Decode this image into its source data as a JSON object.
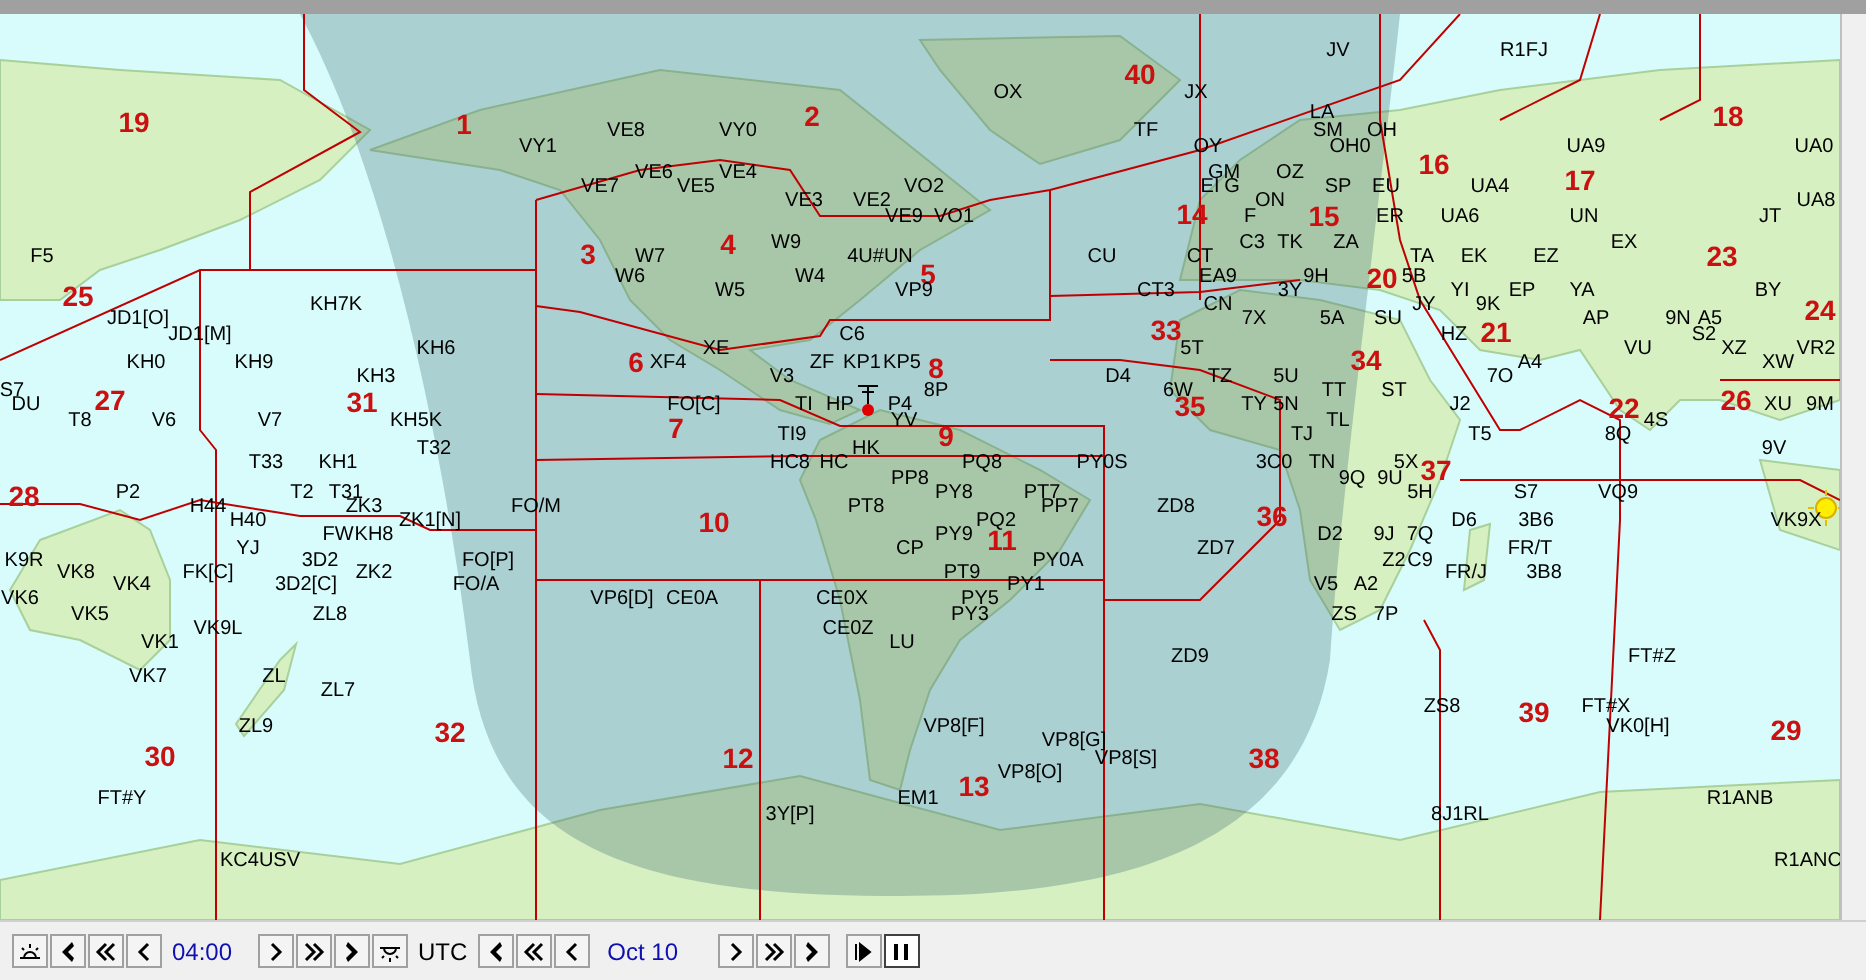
{
  "map": {
    "zones": [
      "40",
      "19",
      "1",
      "2",
      "18",
      "16",
      "17",
      "14",
      "15",
      "3",
      "4",
      "23",
      "5",
      "20",
      "25",
      "24",
      "33",
      "21",
      "6",
      "8",
      "34",
      "27",
      "31",
      "35",
      "22",
      "26",
      "7",
      "9",
      "37",
      "28",
      "10",
      "36",
      "11",
      "39",
      "32",
      "29",
      "30",
      "12",
      "38",
      "13"
    ],
    "prefixes": [
      "JV",
      "R1FJ",
      "OX",
      "JX",
      "LA",
      "VE8",
      "VY0",
      "TF",
      "SM",
      "OH",
      "VY1",
      "OY",
      "OH0",
      "UA9",
      "UA0",
      "VE6",
      "VE4",
      "GM",
      "OZ",
      "VE7",
      "VE5",
      "VO2",
      "EI",
      "G",
      "SP",
      "EU",
      "UA4",
      "VE3",
      "VE2",
      "ON",
      "UA8",
      "VE9",
      "VO1",
      "F",
      "ER",
      "UA6",
      "UN",
      "JT",
      "W9",
      "C3",
      "TK",
      "ZA",
      "EX",
      "F5",
      "W7",
      "4U#UN",
      "CU",
      "CT",
      "TA",
      "EK",
      "EZ",
      "W6",
      "W4",
      "EA9",
      "9H",
      "5B",
      "W5",
      "VP9",
      "CT3",
      "3Y",
      "YI",
      "EP",
      "YA",
      "BY",
      "KH7K",
      "CN",
      "JY",
      "9K",
      "JD1[O]",
      "7X",
      "5A",
      "SU",
      "AP",
      "9N",
      "A5",
      "JD1[M]",
      "C6",
      "HZ",
      "S2",
      "KH6",
      "XE",
      "5T",
      "VU",
      "XZ",
      "VR2",
      "KH0",
      "KH9",
      "XF4",
      "ZF",
      "KP1",
      "KP5",
      "A4",
      "XW",
      "KH3",
      "V3",
      "D4",
      "TZ",
      "5U",
      "7O",
      "S7",
      "8P",
      "6W",
      "TT",
      "ST",
      "DU",
      "FO[C]",
      "TI",
      "HP",
      "P4",
      "TY",
      "5N",
      "J2",
      "XU",
      "9M",
      "T8",
      "V6",
      "V7",
      "KH5K",
      "YV",
      "TL",
      "4S",
      "TI9",
      "TJ",
      "T5",
      "8Q",
      "T32",
      "HK",
      "9V",
      "T33",
      "KH1",
      "HC8",
      "HC",
      "PQ8",
      "PY0S",
      "3C0",
      "TN",
      "5X",
      "PP8",
      "9Q",
      "9U",
      "P2",
      "T2",
      "T31",
      "PY8",
      "PT7",
      "5H",
      "S7",
      "VQ9",
      "H44",
      "ZK3",
      "FO/M",
      "PT8",
      "PP7",
      "ZD8",
      "H40",
      "ZK1[N]",
      "PQ2",
      "D6",
      "3B6",
      "VK9X",
      "FW",
      "KH8",
      "PY9",
      "D2",
      "9J",
      "7Q",
      "YJ",
      "CP",
      "ZD7",
      "FR/T",
      "K9R",
      "3D2",
      "FO[P]",
      "PY0A",
      "Z2",
      "C9",
      "VK8",
      "FK[C]",
      "ZK2",
      "PT9",
      "FR/J",
      "3B8",
      "VK4",
      "3D2[C]",
      "FO/A",
      "PY1",
      "V5",
      "A2",
      "VK6",
      "VP6[D]",
      "CE0A",
      "CE0X",
      "PY5",
      "VK5",
      "ZL8",
      "PY3",
      "ZS",
      "7P",
      "VK9L",
      "CE0Z",
      "VK1",
      "LU",
      "ZD9",
      "FT#Z",
      "VK7",
      "ZL",
      "ZL7",
      "ZS8",
      "FT#X",
      "ZL9",
      "VP8[F]",
      "VK0[H]",
      "VP8[G]",
      "VP8[S]",
      "VP8[O]",
      "FT#Y",
      "EM1",
      "R1ANB",
      "3Y[P]",
      "8J1RL",
      "KC4USV",
      "R1ANC"
    ]
  },
  "toolbar": {
    "time_buttons": [
      {
        "kind": "sunrise"
      },
      {
        "kind": "first"
      },
      {
        "kind": "fast-back"
      },
      {
        "kind": "back"
      }
    ],
    "time": "04:00",
    "time_buttons_after": [
      {
        "kind": "forward"
      },
      {
        "kind": "fast-forward"
      },
      {
        "kind": "last"
      },
      {
        "kind": "sunset"
      }
    ],
    "utc_label": "UTC",
    "date_buttons": [
      {
        "kind": "first"
      },
      {
        "kind": "fast-back"
      },
      {
        "kind": "back"
      }
    ],
    "date": "Oct 10",
    "date_buttons_after": [
      {
        "kind": "forward"
      },
      {
        "kind": "fast-forward"
      },
      {
        "kind": "last"
      }
    ],
    "playback": [
      {
        "kind": "step"
      },
      {
        "kind": "pause",
        "selected": true
      }
    ]
  }
}
